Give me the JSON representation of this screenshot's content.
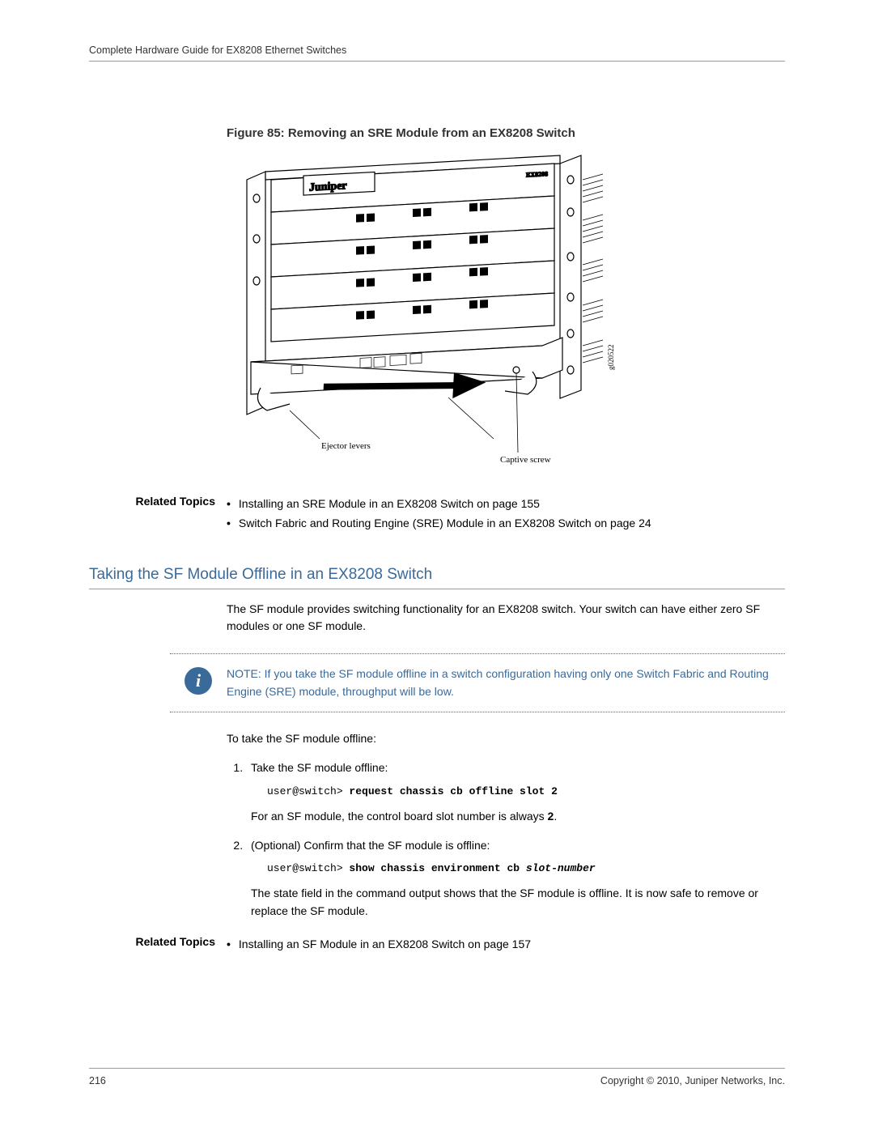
{
  "header": {
    "running_title": "Complete Hardware Guide for EX8208 Ethernet Switches"
  },
  "figure": {
    "caption": "Figure 85: Removing an SRE Module from an EX8208 Switch",
    "label_ejector": "Ejector levers",
    "label_captive": "Captive screw",
    "brand": "Juniper",
    "product": "EX8208",
    "code": "g020522"
  },
  "related1": {
    "label": "Related Topics",
    "items": [
      "Installing an SRE Module in an EX8208 Switch on page 155",
      "Switch Fabric and Routing Engine (SRE) Module in an EX8208 Switch on page 24"
    ]
  },
  "section": {
    "heading": "Taking the SF Module Offline in an EX8208 Switch",
    "intro": "The SF module provides switching functionality for an EX8208 switch. Your switch can have either zero SF modules or one SF module.",
    "note": "NOTE:  If you take the SF module offline in a switch configuration having only one Switch Fabric and Routing Engine (SRE) module, throughput will be low.",
    "proc_lead": "To take the SF module offline:",
    "step1_text": "Take the SF module offline:",
    "step1_cmd_prompt": "user@switch> ",
    "step1_cmd_bold": "request chassis cb offline slot 2",
    "step1_after": "For an SF module, the control board slot number is always ",
    "step1_after_bold": "2",
    "step1_after_tail": ".",
    "step2_text": "(Optional) Confirm that the SF module is offline:",
    "step2_cmd_prompt": "user@switch> ",
    "step2_cmd_bold": "show chassis environment cb ",
    "step2_cmd_arg": "slot-number",
    "step2_after": "The state field in the command output shows that the SF module is offline. It is now safe to remove or replace the SF module."
  },
  "related2": {
    "label": "Related Topics",
    "items": [
      "Installing an SF Module in an EX8208 Switch on page 157"
    ]
  },
  "footer": {
    "page": "216",
    "copyright": "Copyright © 2010, Juniper Networks, Inc."
  }
}
